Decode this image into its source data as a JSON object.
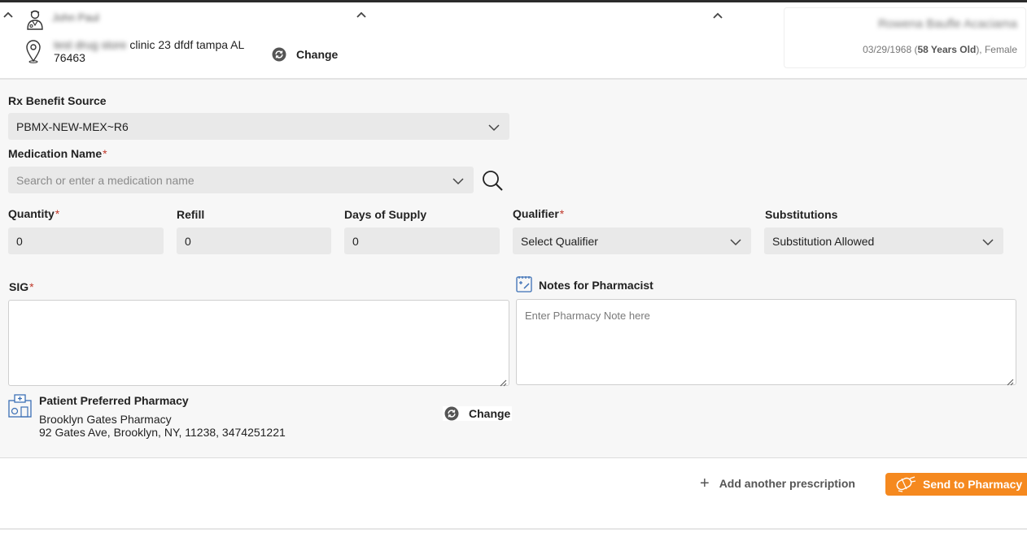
{
  "header": {
    "provider_name": "John Paul",
    "clinic_prefix": "test drug store",
    "clinic_address": " clinic 23 dfdf tampa AL 76463",
    "change_location_label": "Change",
    "patient": {
      "name": "Rowena Baufle Acaciama",
      "dob": "03/29/1968",
      "age_open": " (",
      "age": "58 Years Old",
      "sex_suffix": "), Female"
    }
  },
  "form": {
    "benefit_source": {
      "label": "Rx Benefit Source",
      "value": "PBMX-NEW-MEX~R6"
    },
    "medication": {
      "label": "Medication Name",
      "required_mark": "*",
      "placeholder": "Search or enter a medication name"
    },
    "quantity": {
      "label": "Quantity",
      "required_mark": "*",
      "value": "0"
    },
    "refill": {
      "label": "Refill",
      "value": "0"
    },
    "days_supply": {
      "label": "Days of Supply",
      "value": "0"
    },
    "qualifier": {
      "label": "Qualifier",
      "required_mark": "*",
      "value": "Select Qualifier"
    },
    "substitutions": {
      "label": "Substitutions",
      "value": "Substitution Allowed"
    },
    "sig": {
      "label": "SIG",
      "required_mark": "*"
    },
    "notes": {
      "label": "Notes for Pharmacist",
      "placeholder": "Enter Pharmacy Note here"
    },
    "pharmacy": {
      "label": "Patient Preferred Pharmacy",
      "name": "Brooklyn Gates Pharmacy",
      "address": "92 Gates Ave, Brooklyn, NY, 11238, 3474251221",
      "change_label": "Change"
    }
  },
  "footer": {
    "add_prescription_label": "Add another prescription",
    "send_label": "Send to Pharmacy"
  },
  "colors": {
    "accent_orange": "#f5891f",
    "required_red": "#c0392b",
    "field_bg": "#e9e9e9"
  },
  "icons": [
    "chevron-up-icon",
    "doctor-icon",
    "location-pin-icon",
    "refresh-icon",
    "chevron-down-icon",
    "search-icon",
    "notes-icon",
    "pharmacy-icon",
    "plus-icon",
    "send-pill-icon"
  ]
}
